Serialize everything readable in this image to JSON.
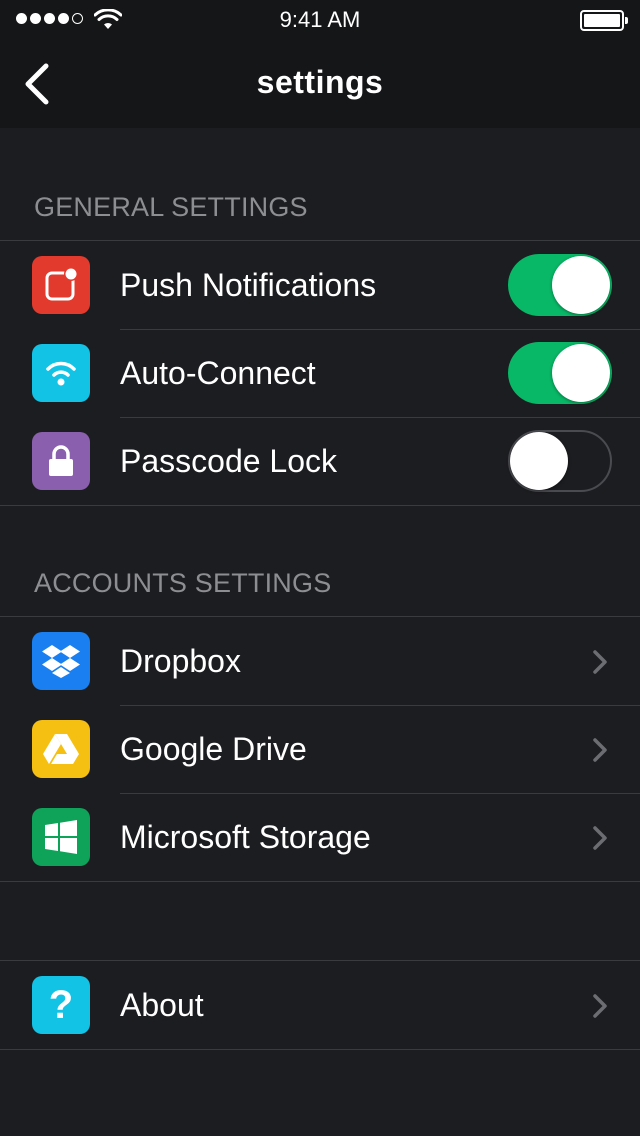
{
  "status_bar": {
    "time": "9:41 AM",
    "signal_bars": 4,
    "signal_total": 5
  },
  "nav": {
    "title": "settings",
    "back_icon": "chevron-left-icon"
  },
  "general": {
    "header": "GENERAL SETTINGS",
    "items": [
      {
        "label": "Push Notifications",
        "icon": "notification-icon",
        "color": "#e23b2e",
        "toggle_on": true
      },
      {
        "label": "Auto-Connect",
        "icon": "wifi-icon",
        "color": "#12c3e6",
        "toggle_on": true
      },
      {
        "label": "Passcode Lock",
        "icon": "lock-icon",
        "color": "#8a5fae",
        "toggle_on": false
      }
    ]
  },
  "accounts": {
    "header": "ACCOUNTS SETTINGS",
    "items": [
      {
        "label": "Dropbox",
        "icon": "dropbox-icon",
        "color": "#1a7ff0"
      },
      {
        "label": "Google Drive",
        "icon": "google-drive-icon",
        "color": "#f6c012"
      },
      {
        "label": "Microsoft Storage",
        "icon": "windows-icon",
        "color": "#0fa35a"
      }
    ]
  },
  "about": {
    "items": [
      {
        "label": "About",
        "icon": "question-icon",
        "color": "#12c3e6"
      }
    ]
  },
  "colors": {
    "background": "#1c1d20",
    "bar": "#151618",
    "toggle_on": "#08b866",
    "separator": "#3a3b3f",
    "section_header": "#8d8e92"
  }
}
